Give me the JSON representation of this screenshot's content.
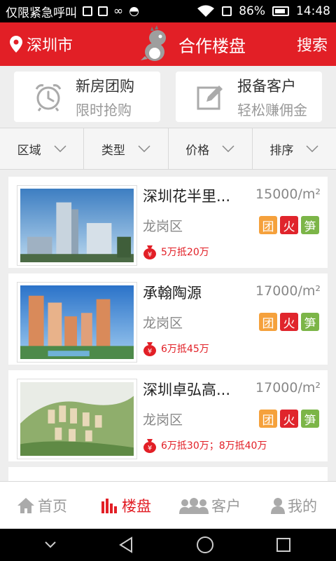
{
  "status_bar": {
    "carrier_text": "仅限紧急呼叫",
    "battery": "86%",
    "time": "14:48"
  },
  "header": {
    "city": "深圳市",
    "title": "合作楼盘",
    "search_label": "搜索",
    "brand_color": "#e21f26"
  },
  "promos": [
    {
      "title": "新房团购",
      "subtitle": "限时抢购",
      "icon": "alarm-clock-icon"
    },
    {
      "title": "报备客户",
      "subtitle": "轻松赚佣金",
      "icon": "edit-icon"
    }
  ],
  "filters": [
    {
      "label": "区域"
    },
    {
      "label": "类型"
    },
    {
      "label": "价格"
    },
    {
      "label": "排序"
    }
  ],
  "listings": [
    {
      "name": "深圳花半里...",
      "price": "15000/m²",
      "district": "龙岗区",
      "tags": [
        "团",
        "火",
        "笋"
      ],
      "deal": "5万抵20万"
    },
    {
      "name": "承翰陶源",
      "price": "17000/m²",
      "district": "龙岗区",
      "tags": [
        "团",
        "火",
        "笋"
      ],
      "deal": "6万抵45万"
    },
    {
      "name": "深圳卓弘高...",
      "price": "17000/m²",
      "district": "龙岗区",
      "tags": [
        "团",
        "火",
        "笋"
      ],
      "deal": "6万抵30万；8万抵40万"
    }
  ],
  "bottom_nav": [
    {
      "label": "首页",
      "icon": "home-icon",
      "active": false
    },
    {
      "label": "楼盘",
      "icon": "bar-chart-icon",
      "active": true
    },
    {
      "label": "客户",
      "icon": "people-icon",
      "active": false
    },
    {
      "label": "我的",
      "icon": "person-icon",
      "active": false
    }
  ]
}
